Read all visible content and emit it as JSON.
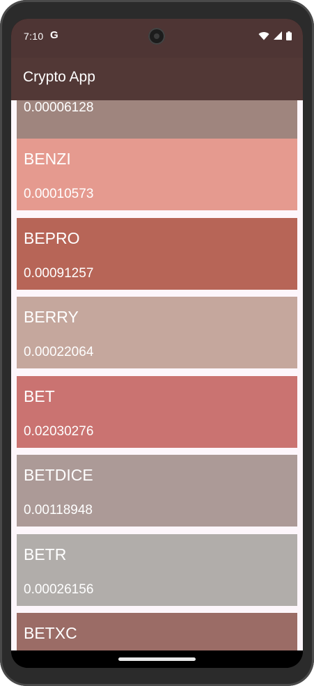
{
  "status_bar": {
    "time": "7:10",
    "google_glyph": "G",
    "icons": [
      "wifi-icon",
      "signal-icon",
      "battery-icon"
    ]
  },
  "app_bar": {
    "title": "Crypto App",
    "color": "#523836"
  },
  "coins": [
    {
      "symbol": "",
      "price": "0.00006128",
      "color": "#9f857e"
    },
    {
      "symbol": "BENZI",
      "price": "0.00010573",
      "color": "#e59a8f"
    },
    {
      "symbol": "BEPRO",
      "price": "0.00091257",
      "color": "#b76557"
    },
    {
      "symbol": "BERRY",
      "price": "0.00022064",
      "color": "#c5a79d"
    },
    {
      "symbol": "BET",
      "price": "0.02030276",
      "color": "#ca7371"
    },
    {
      "symbol": "BETDICE",
      "price": "0.00118948",
      "color": "#ac9a97"
    },
    {
      "symbol": "BETR",
      "price": "0.00026156",
      "color": "#b1adaa"
    },
    {
      "symbol": "BETXC",
      "price": "",
      "color": "#9b6c66"
    }
  ]
}
